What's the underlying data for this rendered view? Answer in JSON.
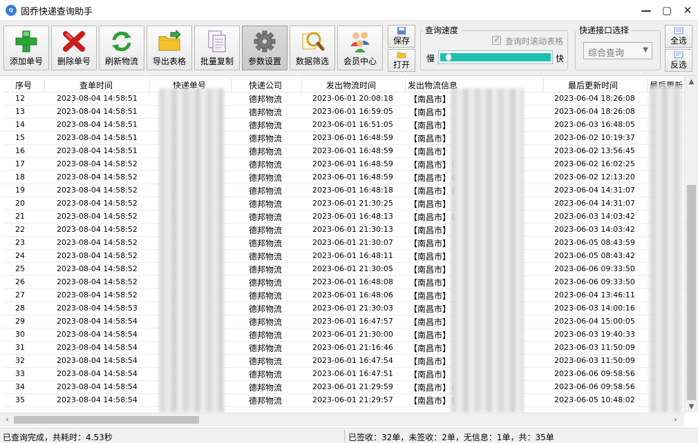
{
  "window": {
    "title": "固乔快递查询助手",
    "icon": "app-logo-icon",
    "min_glyph": "—",
    "max_glyph": "▢",
    "close_glyph": "✕"
  },
  "toolbar": {
    "buttons": [
      {
        "label": "添加单号",
        "icon": "green-plus-icon"
      },
      {
        "label": "删除单号",
        "icon": "red-x-icon"
      },
      {
        "label": "刷新物流",
        "icon": "refresh-icon"
      },
      {
        "label": "导出表格",
        "icon": "folder-export-icon"
      },
      {
        "label": "批量复制",
        "icon": "copy-documents-icon"
      },
      {
        "label": "参数设置",
        "icon": "gear-icon"
      },
      {
        "label": "数据筛选",
        "icon": "magnifier-filter-icon"
      },
      {
        "label": "会员中心",
        "icon": "users-icon"
      }
    ],
    "save_label": "保存",
    "open_label": "打开",
    "select_all_label": "全选",
    "invert_label": "反选"
  },
  "speed": {
    "group_title": "查询速度",
    "scroll_checkbox_label": "查询时滚动表格",
    "scroll_checkbox_checked": true,
    "slow_label": "慢",
    "fast_label": "快",
    "level": 0.05
  },
  "api": {
    "group_title": "快递接口选择",
    "selected": "综合查询"
  },
  "table": {
    "columns": [
      "序号",
      "查单时间",
      "快递单号",
      "快递公司",
      "发出物流时间",
      "发出物流信息",
      "最后更新时间",
      "最后更新"
    ],
    "rows": [
      {
        "no": "12",
        "query_time": "2023-08-04 14:58:51",
        "company": "德邦物流",
        "sent_time": "2023-06-01 20:08:18",
        "sent_info": "【南昌市】",
        "update_time": "2023-06-04 18:26:08"
      },
      {
        "no": "13",
        "query_time": "2023-08-04 14:58:51",
        "company": "德邦物流",
        "sent_time": "2023-06-01 16:59:05",
        "sent_info": "【南昌市】",
        "update_time": "2023-06-04 18:26:08"
      },
      {
        "no": "14",
        "query_time": "2023-08-04 14:58:51",
        "company": "德邦物流",
        "sent_time": "2023-06-01 16:51:05",
        "sent_info": "【南昌市】",
        "update_time": "2023-06-03 16:48:05"
      },
      {
        "no": "15",
        "query_time": "2023-08-04 14:58:51",
        "company": "德邦物流",
        "sent_time": "2023-06-01 16:48:59",
        "sent_info": "【南昌市】",
        "update_time": "2023-06-02 10:19:37"
      },
      {
        "no": "16",
        "query_time": "2023-08-04 14:58:51",
        "company": "德邦物流",
        "sent_time": "2023-06-01 16:48:59",
        "sent_info": "【南昌市】",
        "update_time": "2023-06-02 13:56:45"
      },
      {
        "no": "17",
        "query_time": "2023-08-04 14:58:52",
        "company": "德邦物流",
        "sent_time": "2023-06-01 16:48:59",
        "sent_info": "【南昌市】（",
        "update_time": "2023-06-02 16:02:25"
      },
      {
        "no": "18",
        "query_time": "2023-08-04 14:58:52",
        "company": "德邦物流",
        "sent_time": "2023-06-01 16:48:59",
        "sent_info": "【南昌市】（",
        "update_time": "2023-06-02 12:13:20"
      },
      {
        "no": "19",
        "query_time": "2023-08-04 14:58:52",
        "company": "德邦物流",
        "sent_time": "2023-06-01 16:48:18",
        "sent_info": "【南昌市】（",
        "update_time": "2023-06-04 14:31:07"
      },
      {
        "no": "20",
        "query_time": "2023-08-04 14:58:52",
        "company": "德邦物流",
        "sent_time": "2023-06-01 21:30:25",
        "sent_info": "【南昌市】",
        "update_time": "2023-06-04 14:31:07"
      },
      {
        "no": "21",
        "query_time": "2023-08-04 14:58:52",
        "company": "德邦物流",
        "sent_time": "2023-06-01 16:48:13",
        "sent_info": "【南昌市】（",
        "update_time": "2023-06-03 14:03:42"
      },
      {
        "no": "22",
        "query_time": "2023-08-04 14:58:52",
        "company": "德邦物流",
        "sent_time": "2023-06-01 21:30:13",
        "sent_info": "【南昌市】",
        "update_time": "2023-06-03 14:03:42"
      },
      {
        "no": "23",
        "query_time": "2023-08-04 14:58:52",
        "company": "德邦物流",
        "sent_time": "2023-06-01 21:30:07",
        "sent_info": "【南昌市】",
        "update_time": "2023-06-05 08:43:59"
      },
      {
        "no": "24",
        "query_time": "2023-08-04 14:58:52",
        "company": "德邦物流",
        "sent_time": "2023-06-01 16:48:11",
        "sent_info": "【南昌市】",
        "update_time": "2023-06-05 08:43:42"
      },
      {
        "no": "25",
        "query_time": "2023-08-04 14:58:52",
        "company": "德邦物流",
        "sent_time": "2023-06-01 21:30:05",
        "sent_info": "【南昌市】",
        "update_time": "2023-06-06 09:33:50"
      },
      {
        "no": "26",
        "query_time": "2023-08-04 14:58:52",
        "company": "德邦物流",
        "sent_time": "2023-06-01 16:48:08",
        "sent_info": "【南昌市】",
        "update_time": "2023-06-06 09:33:50"
      },
      {
        "no": "27",
        "query_time": "2023-08-04 14:58:52",
        "company": "德邦物流",
        "sent_time": "2023-06-01 16:48:06",
        "sent_info": "【南昌市】",
        "update_time": "2023-06-04 13:46:11"
      },
      {
        "no": "28",
        "query_time": "2023-08-04 14:58:53",
        "company": "德邦物流",
        "sent_time": "2023-06-01 21:30:03",
        "sent_info": "【南昌市】",
        "update_time": "2023-06-03 14:00:16"
      },
      {
        "no": "29",
        "query_time": "2023-08-04 14:58:54",
        "company": "德邦物流",
        "sent_time": "2023-06-01 16:47:57",
        "sent_info": "【南昌市】",
        "update_time": "2023-06-04 15:00:05"
      },
      {
        "no": "30",
        "query_time": "2023-08-04 14:58:54",
        "company": "德邦物流",
        "sent_time": "2023-06-01 21:30:00",
        "sent_info": "【南昌市】",
        "update_time": "2023-06-03 19:40:33"
      },
      {
        "no": "31",
        "query_time": "2023-08-04 14:58:54",
        "company": "德邦物流",
        "sent_time": "2023-06-01 21:16:46",
        "sent_info": "【南昌市】",
        "update_time": "2023-06-03 11:50:09"
      },
      {
        "no": "32",
        "query_time": "2023-08-04 14:58:54",
        "company": "德邦物流",
        "sent_time": "2023-06-01 16:47:54",
        "sent_info": "【南昌市】",
        "update_time": "2023-06-03 11:50:09"
      },
      {
        "no": "33",
        "query_time": "2023-08-04 14:58:54",
        "company": "德邦物流",
        "sent_time": "2023-06-01 16:47:51",
        "sent_info": "【南昌市】",
        "update_time": "2023-06-06 09:58:56"
      },
      {
        "no": "34",
        "query_time": "2023-08-04 14:58:54",
        "company": "德邦物流",
        "sent_time": "2023-06-01 21:29:59",
        "sent_info": "【南昌市】（",
        "update_time": "2023-06-06 09:58:56"
      },
      {
        "no": "35",
        "query_time": "2023-08-04 14:58:54",
        "company": "德邦物流",
        "sent_time": "2023-06-01 21:29:57",
        "sent_info": "【南昌市】（",
        "update_time": "2023-06-05 10:48:02"
      }
    ]
  },
  "status": {
    "left": "已查询完成，共耗时：4.53秒",
    "right": "已签收：32单，未签收：2单，无信息：1单，共：35单"
  },
  "colors": {
    "slider_fill": "#1fbfb2",
    "brand_blue": "#3a7bd5"
  }
}
